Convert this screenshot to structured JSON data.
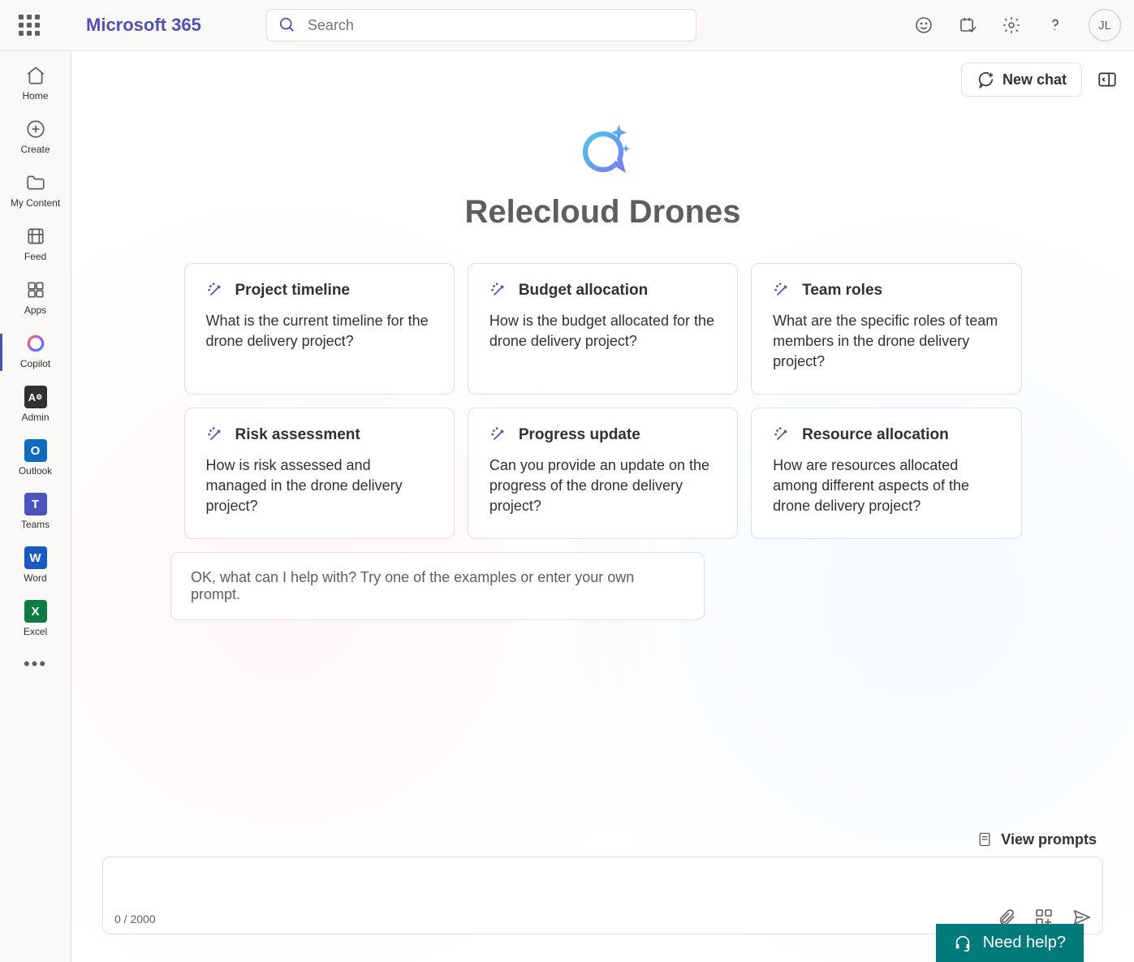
{
  "header": {
    "brand": "Microsoft 365",
    "search_placeholder": "Search",
    "avatar_initials": "JL"
  },
  "sidebar": {
    "items": [
      {
        "label": "Home"
      },
      {
        "label": "Create"
      },
      {
        "label": "My Content"
      },
      {
        "label": "Feed"
      },
      {
        "label": "Apps"
      },
      {
        "label": "Copilot"
      },
      {
        "label": "Admin"
      },
      {
        "label": "Outlook"
      },
      {
        "label": "Teams"
      },
      {
        "label": "Word"
      },
      {
        "label": "Excel"
      }
    ]
  },
  "topbar": {
    "new_chat": "New chat"
  },
  "hero": {
    "title": "Relecloud Drones"
  },
  "cards": [
    {
      "title": "Project timeline",
      "desc": "What is the current timeline for the drone delivery project?"
    },
    {
      "title": "Budget allocation",
      "desc": "How is the budget allocated for the drone delivery project?"
    },
    {
      "title": "Team roles",
      "desc": "What are the specific roles of team members in the drone delivery project?"
    },
    {
      "title": "Risk assessment",
      "desc": "How is risk assessed and managed in the drone delivery project?"
    },
    {
      "title": "Progress update",
      "desc": "Can you provide an update on the progress of the drone delivery project?"
    },
    {
      "title": "Resource allocation",
      "desc": "How are resources allocated among different aspects of the drone delivery project?"
    }
  ],
  "prompt_hint": "OK, what can I help with? Try one of the examples or enter your own prompt.",
  "bottom": {
    "view_prompts": "View prompts",
    "counter": "0 / 2000"
  },
  "need_help": "Need help?"
}
